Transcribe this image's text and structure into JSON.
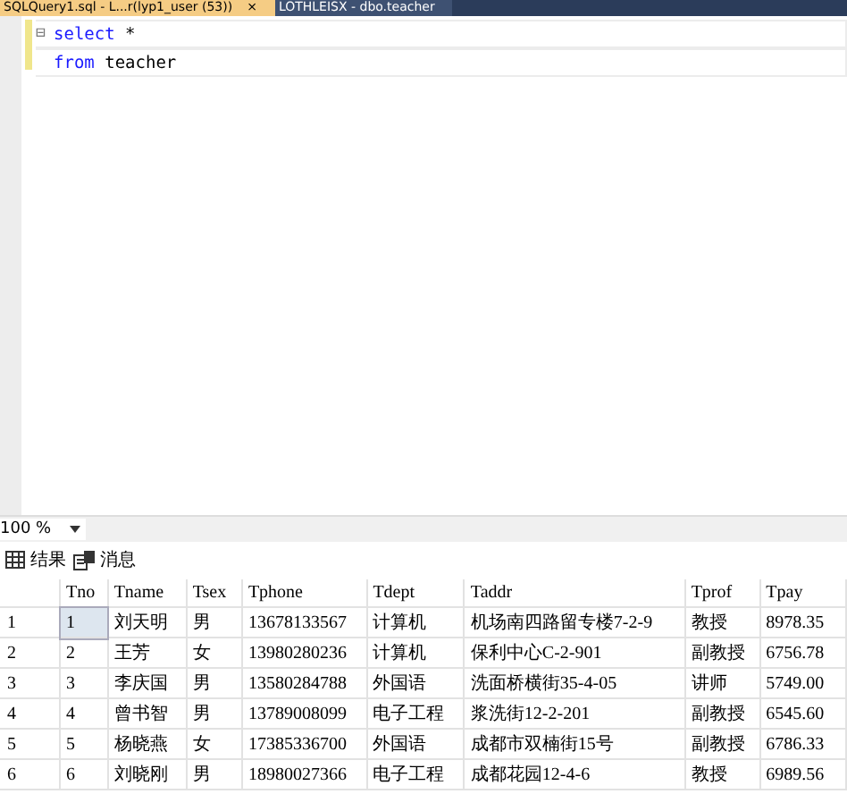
{
  "tabs": [
    {
      "label": "SQLQuery1.sql - L...r(lyp1_user (53))",
      "selected": true,
      "close": "×"
    },
    {
      "label": "LOTHLEISX - dbo.teacher",
      "selected": false
    }
  ],
  "editor": {
    "lines": [
      {
        "fold": "⊟",
        "keyword": "select",
        "rest": " *"
      },
      {
        "keyword": "from",
        "rest": " teacher"
      }
    ]
  },
  "zoom": {
    "value": "100 %"
  },
  "result_tabs": [
    {
      "label": "结果",
      "kind": "grid"
    },
    {
      "label": "消息",
      "kind": "messages"
    }
  ],
  "table": {
    "columns": [
      "Tno",
      "Tname",
      "Tsex",
      "Tphone",
      "Tdept",
      "Taddr",
      "Tprof",
      "Tpay"
    ],
    "rows": [
      {
        "num": "1",
        "selected": true,
        "cells": [
          "1",
          "刘天明",
          "男",
          "13678133567",
          "计算机",
          "机场南四路留专楼7-2-9",
          "教授",
          "8978.35"
        ]
      },
      {
        "num": "2",
        "selected": false,
        "cells": [
          "2",
          "王芳",
          "女",
          "13980280236",
          "计算机",
          "保利中心C-2-901",
          "副教授",
          "6756.78"
        ]
      },
      {
        "num": "3",
        "selected": false,
        "cells": [
          "3",
          "李庆国",
          "男",
          "13580284788",
          "外国语",
          "洗面桥横街35-4-05",
          "讲师",
          "5749.00"
        ]
      },
      {
        "num": "4",
        "selected": false,
        "cells": [
          "4",
          "曾书智",
          "男",
          "13789008099",
          "电子工程",
          "浆洗街12-2-201",
          "副教授",
          "6545.60"
        ]
      },
      {
        "num": "5",
        "selected": false,
        "cells": [
          "5",
          "杨晓燕",
          "女",
          "17385336700",
          "外国语",
          "成都市双楠街15号",
          "副教授",
          "6786.33"
        ]
      },
      {
        "num": "6",
        "selected": false,
        "cells": [
          "6",
          "刘晓刚",
          "男",
          "18980027366",
          "电子工程",
          "成都花园12-4-6",
          "教授",
          "6989.56"
        ]
      }
    ]
  }
}
